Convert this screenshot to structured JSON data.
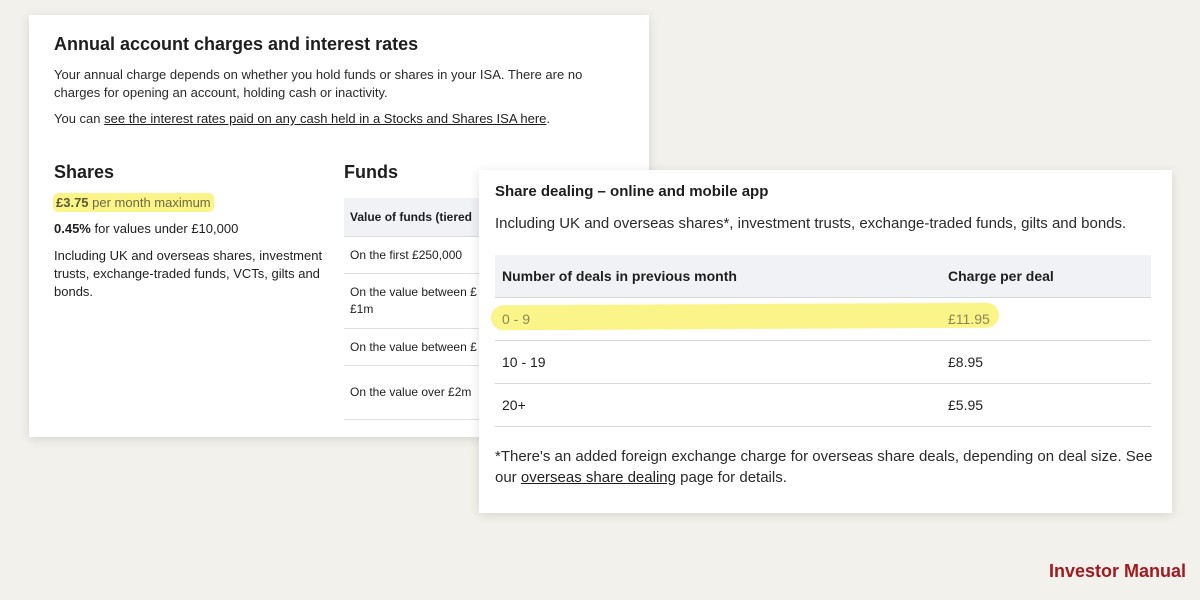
{
  "account_card": {
    "title": "Annual account charges and interest rates",
    "intro": "Your annual charge depends on whether you hold funds or shares in your ISA. There are no charges for opening an account, holding cash or inactivity.",
    "rates_prefix": "You can ",
    "rates_link": "see the interest rates paid on any cash held in a Stocks and Shares ISA here",
    "rates_suffix": ".",
    "shares": {
      "heading": "Shares",
      "price": "£3.75",
      "price_suffix": " per month maximum",
      "pct": "0.45%",
      "pct_suffix": " for values under £10,000",
      "description": "Including UK and overseas shares, investment trusts, exchange-traded funds, VCTs, gilts and bonds."
    },
    "funds": {
      "heading": "Funds",
      "table_header": "Value of funds (tiered",
      "rows": [
        "On the first £250,000",
        "On the value between £ £1m",
        "On the value between £",
        "On the value over £2m"
      ]
    }
  },
  "dealing_card": {
    "title": "Share dealing – online and mobile app",
    "intro": "Including UK and overseas shares*, investment trusts, exchange-traded funds, gilts and bonds.",
    "columns": [
      "Number of deals in previous month",
      "Charge per deal"
    ],
    "rows": [
      {
        "deals": "0 - 9",
        "charge": "£11.95"
      },
      {
        "deals": "10 - 19",
        "charge": "£8.95"
      },
      {
        "deals": "20+",
        "charge": "£5.95"
      }
    ],
    "footnote_prefix": "*There's an added foreign exchange charge for overseas share deals, depending on deal size. See our ",
    "footnote_link": "overseas share dealing",
    "footnote_suffix": " page for details."
  },
  "brand": "Investor Manual",
  "colors": {
    "highlight": "#fbf489",
    "brand": "#a11a20",
    "table_header_bg": "#f1f2f6"
  }
}
